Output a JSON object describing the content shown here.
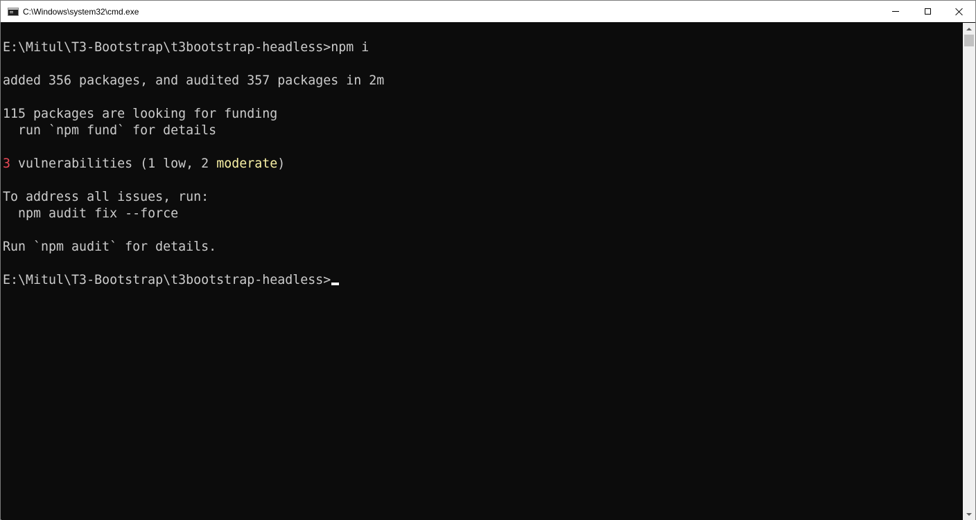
{
  "window": {
    "title": "C:\\Windows\\system32\\cmd.exe",
    "icon": "cmd-icon",
    "controls": {
      "minimize": "minimize-icon",
      "maximize": "maximize-icon",
      "close": "close-icon"
    }
  },
  "console": {
    "lines": [
      {
        "segments": [
          {
            "text": "E:\\Mitul\\T3-Bootstrap\\t3bootstrap-headless>npm i"
          }
        ]
      },
      {
        "segments": [
          {
            "text": ""
          }
        ]
      },
      {
        "segments": [
          {
            "text": "added 356 packages, and audited 357 packages in 2m"
          }
        ]
      },
      {
        "segments": [
          {
            "text": ""
          }
        ]
      },
      {
        "segments": [
          {
            "text": "115 packages are looking for funding"
          }
        ]
      },
      {
        "segments": [
          {
            "text": "  run `npm fund` for details"
          }
        ]
      },
      {
        "segments": [
          {
            "text": ""
          }
        ]
      },
      {
        "segments": [
          {
            "text": "3",
            "color": "red"
          },
          {
            "text": " vulnerabilities (1 low, 2 "
          },
          {
            "text": "moderate",
            "color": "yellow"
          },
          {
            "text": ")"
          }
        ]
      },
      {
        "segments": [
          {
            "text": ""
          }
        ]
      },
      {
        "segments": [
          {
            "text": "To address all issues, run:"
          }
        ]
      },
      {
        "segments": [
          {
            "text": "  npm audit fix --force"
          }
        ]
      },
      {
        "segments": [
          {
            "text": ""
          }
        ]
      },
      {
        "segments": [
          {
            "text": "Run `npm audit` for details."
          }
        ]
      },
      {
        "segments": [
          {
            "text": ""
          }
        ]
      },
      {
        "segments": [
          {
            "text": "E:\\Mitul\\T3-Bootstrap\\t3bootstrap-headless>"
          }
        ],
        "cursor": true
      }
    ],
    "colors": {
      "background": "#0c0c0c",
      "foreground": "#cccccc",
      "red": "#e74856",
      "yellow": "#f9f1a5"
    }
  }
}
